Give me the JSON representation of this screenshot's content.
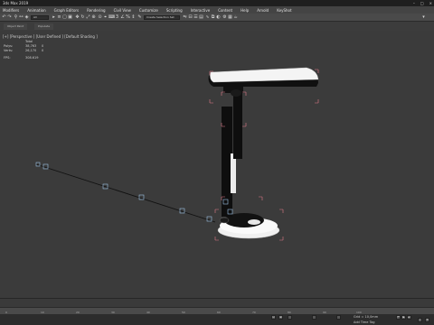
{
  "window": {
    "title": "3ds Max 2019"
  },
  "menu": [
    "Modifiers",
    "Animation",
    "Graph Editors",
    "Rendering",
    "Civil View",
    "Customize",
    "Scripting",
    "Interactive",
    "Content",
    "Help",
    "Arnold",
    "KeyShot"
  ],
  "toolbar": {
    "selection_filter": "All",
    "named_selection": "Create Selection Set"
  },
  "ribbon_tabs": [
    "Object Paint",
    "Populate"
  ],
  "viewport": {
    "label": "[+] [Perspective ] [User Defined ] [Default Shading ]",
    "stats": {
      "header": "Total",
      "polys_label": "Polys:",
      "polys_total": "38,763",
      "polys_sel": "0",
      "verts_label": "Verts:",
      "verts_total": "26,170",
      "verts_sel": "0",
      "fps_label": "FPS:",
      "fps": "308.619"
    }
  },
  "timeline": {
    "ruler_labels": [
      "0",
      "10",
      "20",
      "30",
      "40",
      "50",
      "60",
      "70",
      "80",
      "90",
      "100"
    ]
  },
  "status": {
    "grid": "Grid = 10,0mm",
    "time_tag": "Add Time Tag"
  }
}
